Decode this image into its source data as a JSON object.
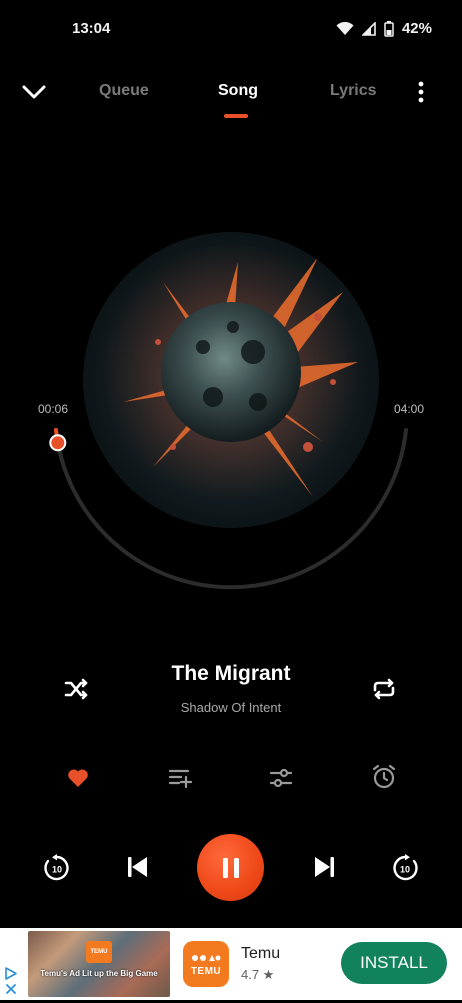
{
  "status_bar": {
    "time": "13:04",
    "battery": "42%"
  },
  "nav": {
    "tabs": [
      {
        "label": "Queue",
        "active": false
      },
      {
        "label": "Song",
        "active": true
      },
      {
        "label": "Lyrics",
        "active": false
      }
    ]
  },
  "player": {
    "elapsed": "00:06",
    "total": "04:00",
    "progress": 0.025,
    "title": "The Migrant",
    "artist": "Shadow Of Intent",
    "favorite": true,
    "playing": true,
    "skip_seconds": "10"
  },
  "colors": {
    "accent": "#e8502a",
    "track": "#2c2c2c",
    "install_green": "#12825c",
    "temu_orange": "#f47a1f"
  },
  "ad": {
    "thumb_caption": "Temu's Ad Lit up the Big Game",
    "thumb_logo": "TEMU",
    "app_icon_text": "TEMU",
    "app_name": "Temu",
    "rating": "4.7 ★",
    "install_label": "INSTALL"
  }
}
